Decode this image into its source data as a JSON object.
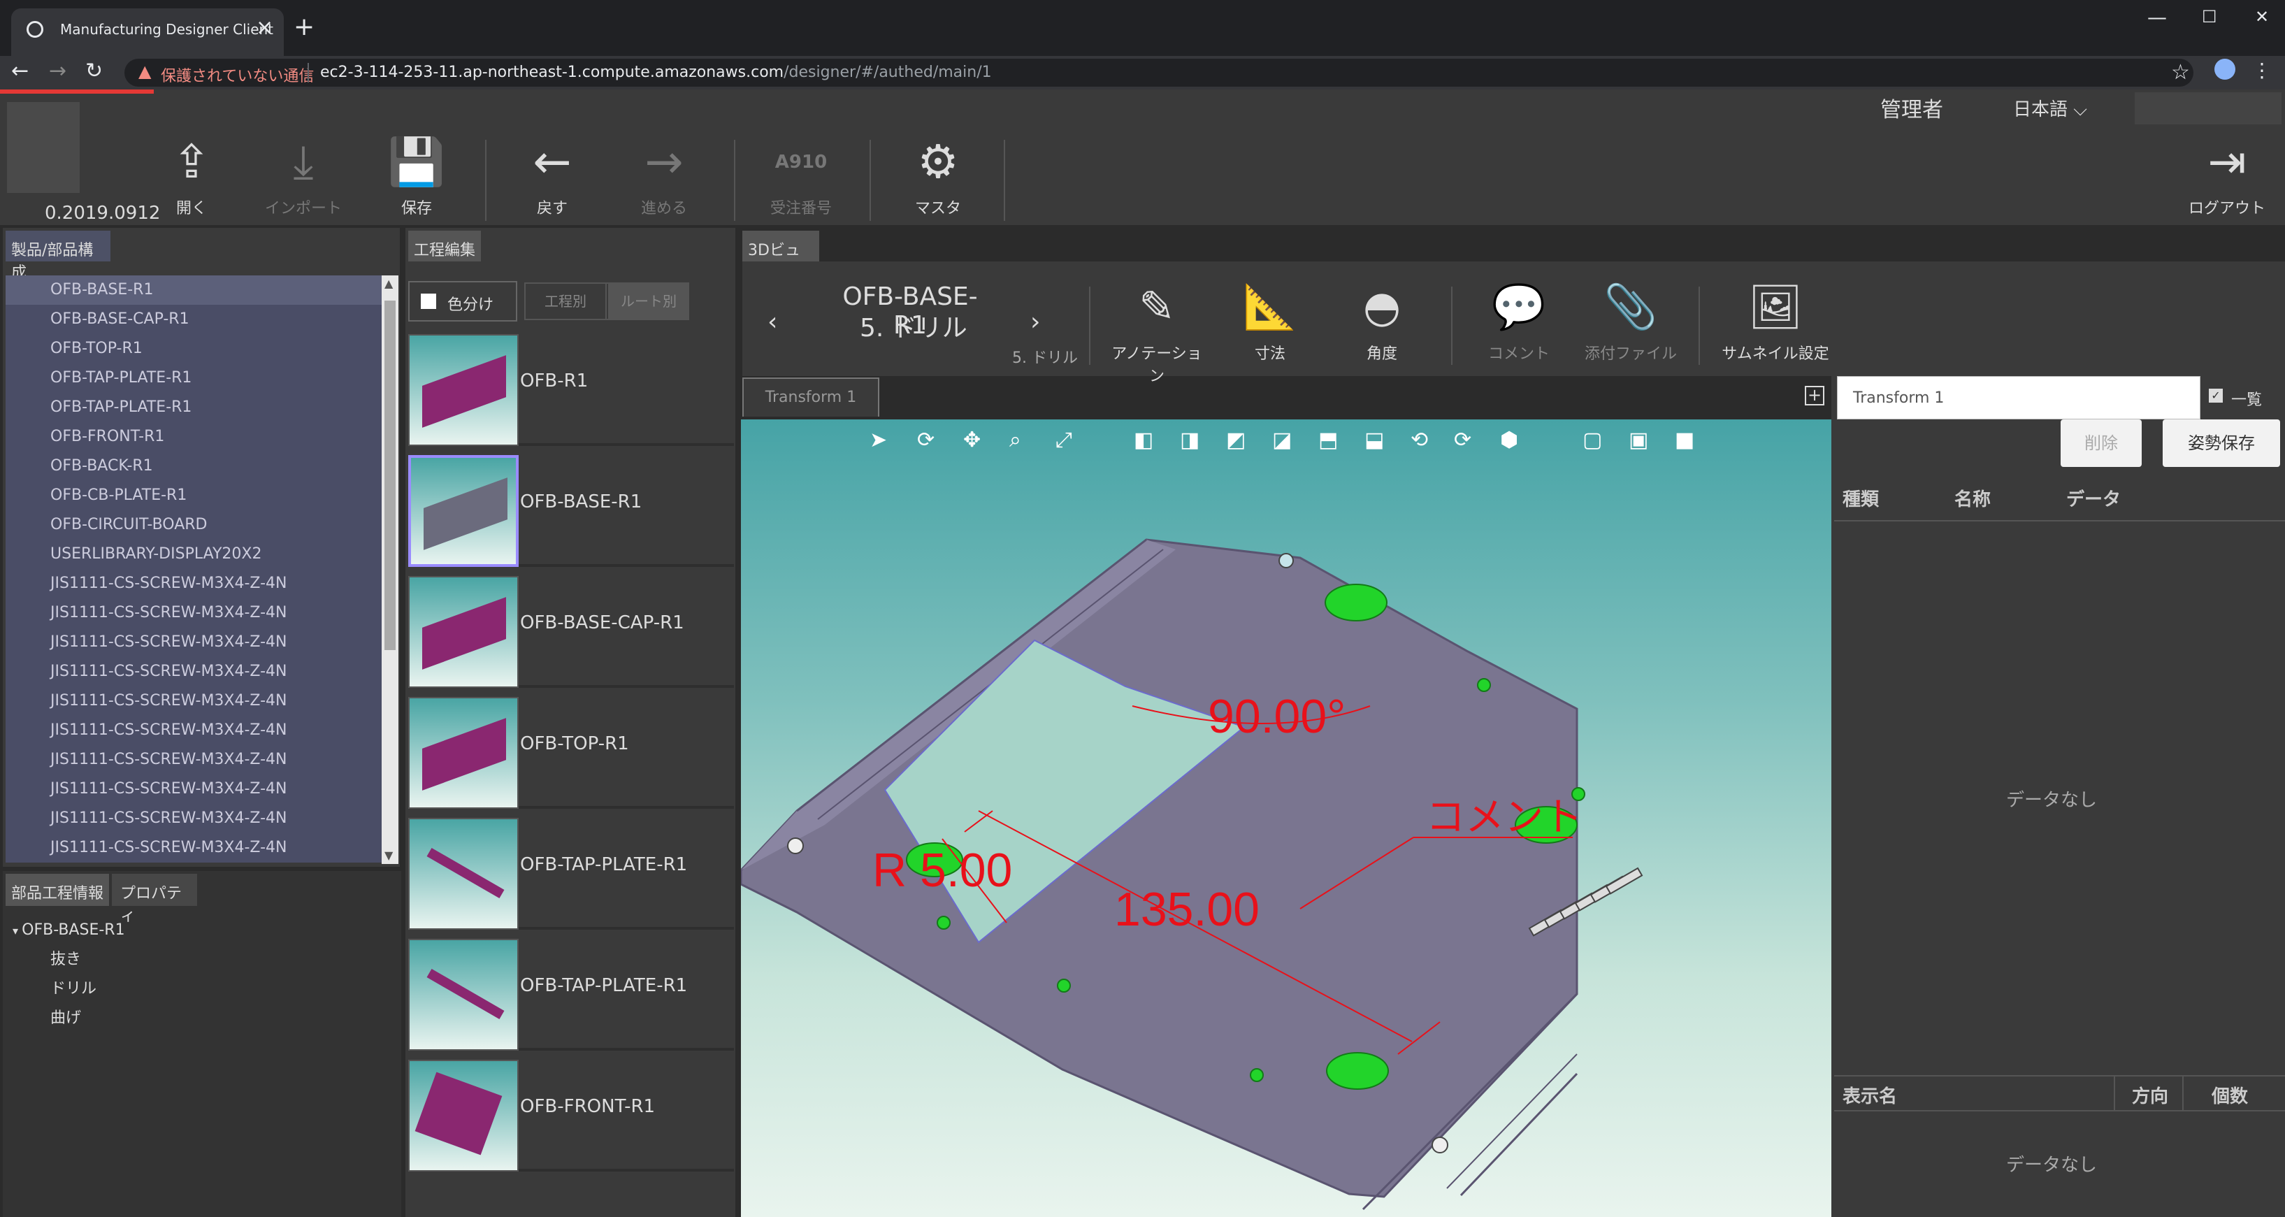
{
  "browser": {
    "tab_title": "Manufacturing Designer Client",
    "new_tab": "+",
    "security_warning": "保護されていない通信",
    "url_host": "ec2-3-114-253-11.ap-northeast-1.compute.amazonaws.com",
    "url_path": "/designer/#/authed/main/1",
    "win_min": "—",
    "win_max": "☐",
    "win_close": "✕"
  },
  "app": {
    "version": "0.2019.0912",
    "user": "管理者",
    "language": "日本語",
    "toolbar": [
      {
        "label": "開く",
        "icon": "upload-icon",
        "glyph": "⇪",
        "enabled": true
      },
      {
        "label": "インポート",
        "icon": "import-icon",
        "glyph": "⤓",
        "enabled": false
      },
      {
        "label": "保存",
        "icon": "save-icon",
        "glyph": "💾",
        "enabled": true
      },
      {
        "label": "戻す",
        "icon": "back-arrow-icon",
        "glyph": "←",
        "enabled": true
      },
      {
        "label": "進める",
        "icon": "forward-arrow-icon",
        "glyph": "→",
        "enabled": false
      },
      {
        "label": "受注番号",
        "icon": "order-number-icon",
        "glyph": "A910",
        "enabled": false
      },
      {
        "label": "マスタ",
        "icon": "gear-icon",
        "glyph": "⚙",
        "enabled": true
      }
    ],
    "logout_label": "ログアウト"
  },
  "left_panel": {
    "header": "製品/部品構成",
    "items": [
      "OFB-BASE-R1",
      "OFB-BASE-CAP-R1",
      "OFB-TOP-R1",
      "OFB-TAP-PLATE-R1",
      "OFB-TAP-PLATE-R1",
      "OFB-FRONT-R1",
      "OFB-BACK-R1",
      "OFB-CB-PLATE-R1",
      "OFB-CIRCUIT-BOARD",
      "USERLIBRARY-DISPLAY20X2",
      "JIS1111-CS-SCREW-M3X4-Z-4N",
      "JIS1111-CS-SCREW-M3X4-Z-4N",
      "JIS1111-CS-SCREW-M3X4-Z-4N",
      "JIS1111-CS-SCREW-M3X4-Z-4N",
      "JIS1111-CS-SCREW-M3X4-Z-4N",
      "JIS1111-CS-SCREW-M3X4-Z-4N",
      "JIS1111-CS-SCREW-M3X4-Z-4N",
      "JIS1111-CS-SCREW-M3X4-Z-4N",
      "JIS1111-CS-SCREW-M3X4-Z-4N",
      "JIS1111-CS-SCREW-M3X4-Z-4N"
    ],
    "bottom_tabs": [
      "部品工程情報",
      "プロパティ"
    ],
    "process_tree": {
      "root": "OFB-BASE-R1",
      "children": [
        "抜き",
        "ドリル",
        "曲げ"
      ]
    }
  },
  "mid_panel": {
    "header": "工程編集",
    "color_toggle": "色分け",
    "seg_process": "工程別",
    "seg_route": "ルート別",
    "parts": [
      "OFB-R1",
      "OFB-BASE-R1",
      "OFB-BASE-CAP-R1",
      "OFB-TOP-R1",
      "OFB-TAP-PLATE-R1",
      "OFB-TAP-PLATE-R1",
      "OFB-FRONT-R1"
    ]
  },
  "view3d": {
    "header": "3Dビュー",
    "part_name": "OFB-BASE-R1",
    "step": "5. ドリル",
    "step_small": "5. ドリル",
    "tools": [
      {
        "label": "アノテーション",
        "icon": "pencil-icon",
        "glyph": "✎",
        "enabled": true
      },
      {
        "label": "寸法",
        "icon": "ruler-icon",
        "glyph": "📐",
        "enabled": true
      },
      {
        "label": "角度",
        "icon": "protractor-icon",
        "glyph": "◓",
        "enabled": true
      },
      {
        "label": "コメント",
        "icon": "comment-icon",
        "glyph": "💬",
        "enabled": false
      },
      {
        "label": "添付ファイル",
        "icon": "paperclip-icon",
        "glyph": "📎",
        "enabled": false
      },
      {
        "label": "サムネイル設定",
        "icon": "image-icon",
        "glyph": "🖼",
        "enabled": true
      }
    ],
    "transform_tab": "Transform 1",
    "annotations": {
      "angle": "90.00°",
      "radius": "R 5.00",
      "distance": "135.00",
      "comment": "コメント"
    }
  },
  "right_panel": {
    "transform_input": "Transform 1",
    "list_label": "一覧",
    "delete_button": "削除",
    "save_pose_button": "姿勢保存",
    "columns": [
      "種類",
      "名称",
      "データ"
    ],
    "no_data_1": "データなし",
    "columns2": [
      "表示名",
      "方向",
      "個数"
    ],
    "no_data_2": "データなし"
  },
  "colors": {
    "accent_red": "#e53935",
    "plate": "#7a7590",
    "hole_green": "#22d42a",
    "dimension_red": "#e8111a"
  }
}
